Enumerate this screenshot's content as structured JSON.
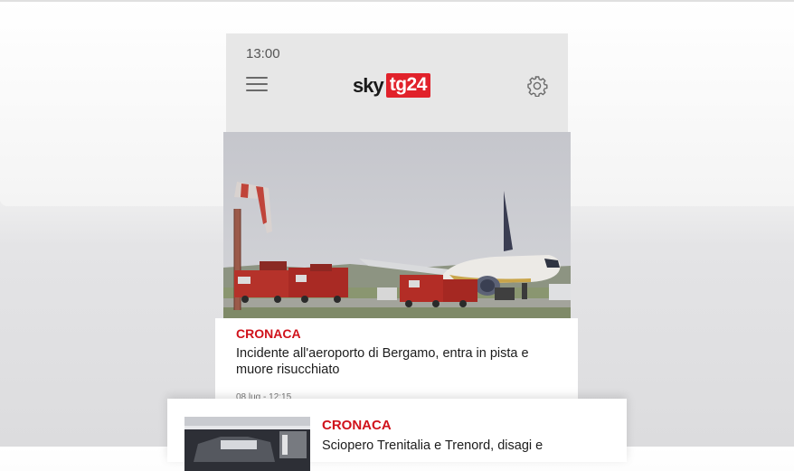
{
  "status_bar": {
    "time": "13:00"
  },
  "app_bar": {
    "logo_sky": "sky",
    "logo_tg": "tg24",
    "menu_icon": "hamburger-menu-icon",
    "settings_icon": "gear-icon"
  },
  "articles": [
    {
      "category": "CRONACA",
      "headline": "Incidente all'aeroporto di Bergamo, entra in pista e muore risucchiato",
      "date": "08 lug - 12:15"
    },
    {
      "category": "CRONACA",
      "headline": "Sciopero Trenitalia e Trenord, disagi e"
    }
  ],
  "colors": {
    "accent": "#e1222b",
    "category": "#d0121b",
    "appbar_bg": "#e7e7e7"
  }
}
